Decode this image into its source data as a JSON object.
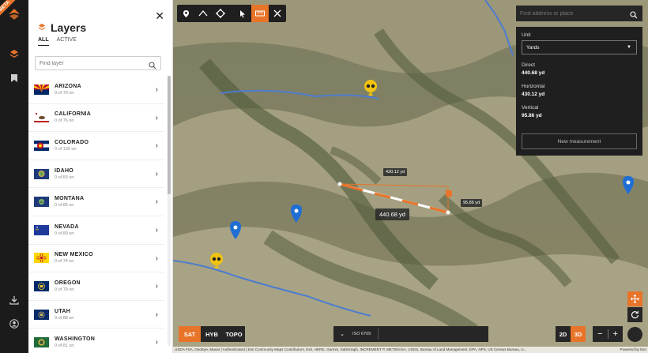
{
  "app": {
    "beta_label": "BETA",
    "accent": "#e8742a"
  },
  "layers_panel": {
    "title": "Layers",
    "tabs": [
      {
        "label": "ALL"
      },
      {
        "label": "ACTIVE"
      }
    ],
    "search_placeholder": "Find layer",
    "states": [
      {
        "name": "ARIZONA",
        "status": "0 of 70 on",
        "flag": "arizona-flag-icon"
      },
      {
        "name": "CALIFORNIA",
        "status": "0 of 76 on",
        "flag": "california-flag-icon"
      },
      {
        "name": "COLORADO",
        "status": "0 of 135 on",
        "flag": "colorado-flag-icon"
      },
      {
        "name": "IDAHO",
        "status": "0 of 83 on",
        "flag": "idaho-flag-icon"
      },
      {
        "name": "MONTANA",
        "status": "0 of 85 on",
        "flag": "montana-flag-icon"
      },
      {
        "name": "NEVADA",
        "status": "0 of 80 on",
        "flag": "nevada-flag-icon"
      },
      {
        "name": "NEW MEXICO",
        "status": "0 of 74 on",
        "flag": "new-mexico-flag-icon"
      },
      {
        "name": "OREGON",
        "status": "0 of 79 on",
        "flag": "oregon-flag-icon"
      },
      {
        "name": "UTAH",
        "status": "0 of 88 on",
        "flag": "utah-flag-icon"
      },
      {
        "name": "WASHINGTON",
        "status": "0 of 81 on",
        "flag": "washington-flag-icon"
      }
    ]
  },
  "map": {
    "search_placeholder": "Find address or place",
    "measurement": {
      "unit_label": "Unit",
      "unit_value": "Yards",
      "direct_label": "Direct",
      "direct_value": "440.68 yd",
      "horizontal_label": "Horizontal",
      "horizontal_value": "430.12 yd",
      "vertical_label": "Vertical",
      "vertical_value": "95.86 yd",
      "new_button": "New measurement"
    },
    "labels": {
      "horizontal": "430.12 yd",
      "vertical": "95.86 yd",
      "direct": "440.68 yd"
    },
    "basemaps": [
      {
        "label": "SAT",
        "active": true
      },
      {
        "label": "HYB",
        "active": false
      },
      {
        "label": "TOPO",
        "active": false
      }
    ],
    "timeline_text": "ISO 6709",
    "dimensions": [
      {
        "label": "2D",
        "active": false
      },
      {
        "label": "3D",
        "active": true
      }
    ],
    "attribution": "USDA FSA, GeoEye, Maxar | Authenticated | Esri Community Maps Contributors, Esri, HERE, Garmin, SafeGraph, INCREMENT P, METI/NASA, USGS, Bureau of Land Management, EPA, NPS, US Census Bureau, U...",
    "powered_by": "Powered by Esri"
  }
}
